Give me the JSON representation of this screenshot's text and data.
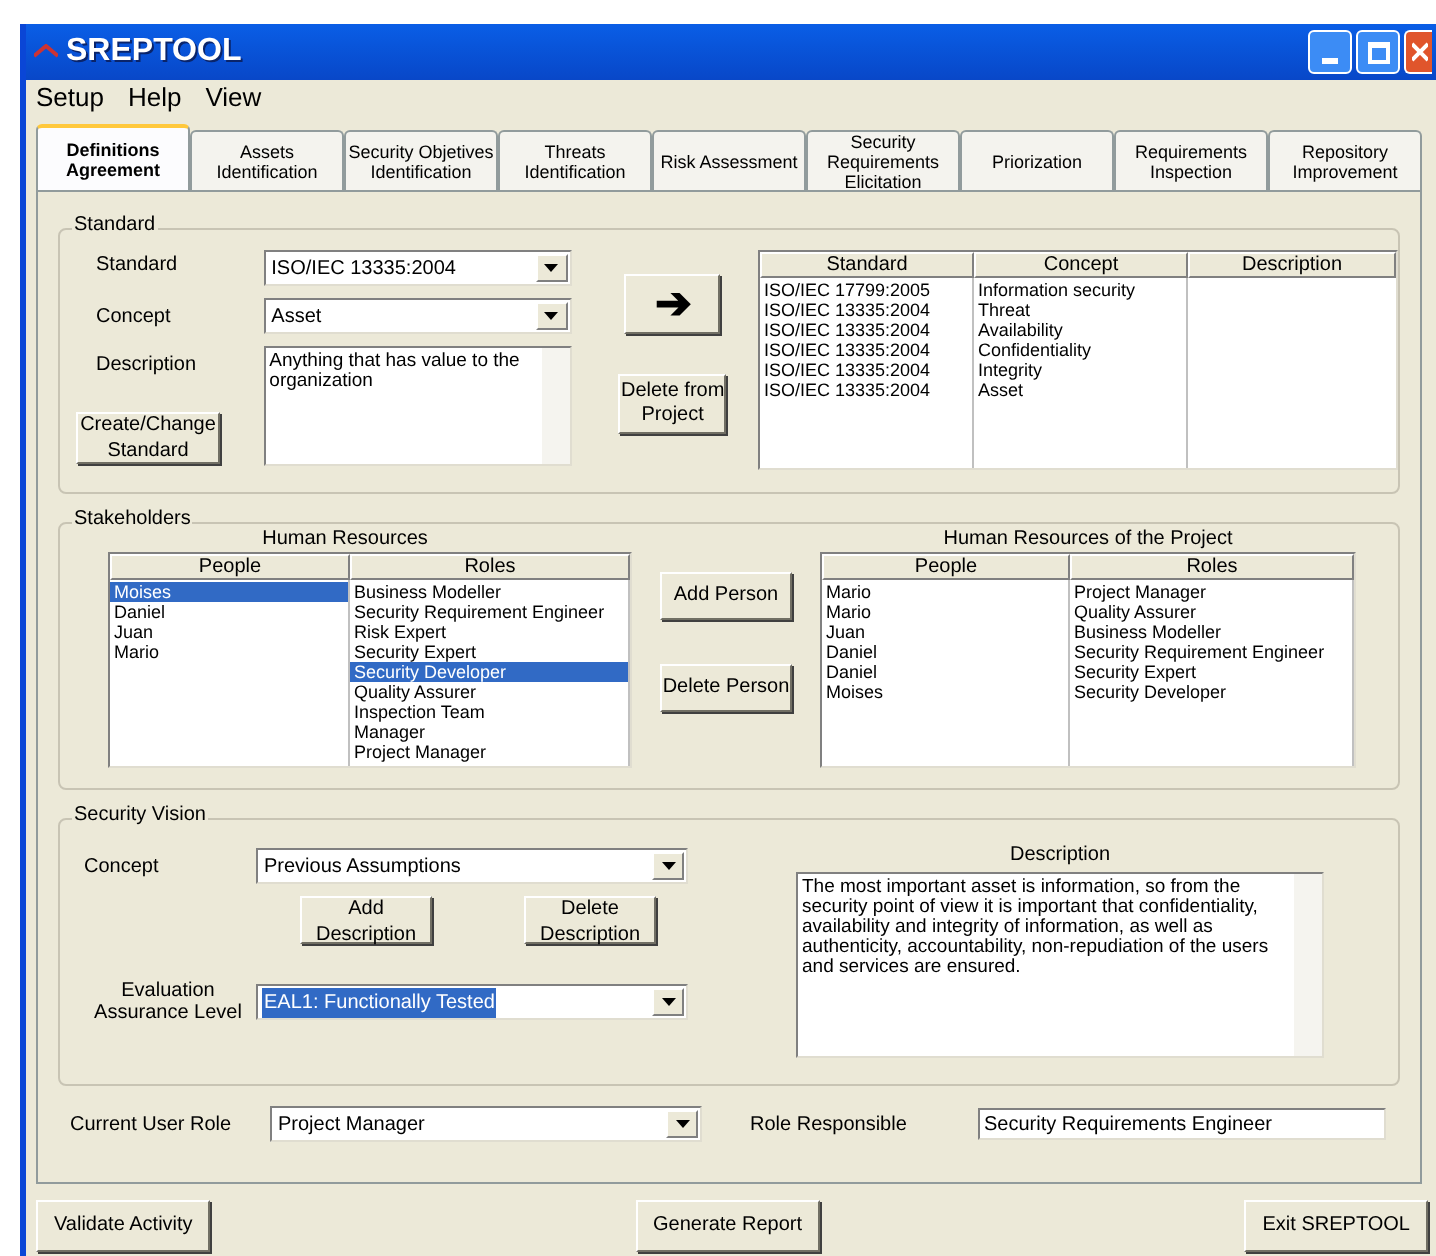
{
  "window": {
    "title": "SREPTOOL"
  },
  "menu": [
    "Setup",
    "Help",
    "View"
  ],
  "tabs": [
    {
      "label": "Definitions Agreement",
      "selected": true
    },
    {
      "label": "Assets Identification",
      "selected": false
    },
    {
      "label": "Security Objetives Identification",
      "selected": false
    },
    {
      "label": "Threats Identification",
      "selected": false
    },
    {
      "label": "Risk Assessment",
      "selected": false
    },
    {
      "label": "Security Requirements Elicitation",
      "selected": false
    },
    {
      "label": "Priorization",
      "selected": false
    },
    {
      "label": "Requirements Inspection",
      "selected": false
    },
    {
      "label": "Repository Improvement",
      "selected": false
    }
  ],
  "standard": {
    "title": "Standard",
    "standard_label": "Standard",
    "standard_value": "ISO/IEC 13335:2004",
    "concept_label": "Concept",
    "concept_value": "Asset",
    "description_label": "Description",
    "description_value": "Anything that has value to the organization",
    "create_button": "Create/Change Standard",
    "add_symbol": "➔",
    "delete_button": "Delete from Project",
    "table": {
      "columns": [
        "Standard",
        "Concept",
        "Description"
      ],
      "rows": [
        {
          "standard": "ISO/IEC 17799:2005",
          "concept": "Information security"
        },
        {
          "standard": "ISO/IEC 13335:2004",
          "concept": "Threat"
        },
        {
          "standard": "ISO/IEC 13335:2004",
          "concept": "Availability"
        },
        {
          "standard": "ISO/IEC 13335:2004",
          "concept": "Confidentiality"
        },
        {
          "standard": "ISO/IEC 13335:2004",
          "concept": "Integrity"
        },
        {
          "standard": "ISO/IEC 13335:2004",
          "concept": "Asset"
        }
      ]
    }
  },
  "stakeholders": {
    "title": "Stakeholders",
    "resources_title": "Human Resources",
    "columns": [
      "People",
      "Roles"
    ],
    "people": [
      {
        "name": "Moises",
        "selected": true
      },
      {
        "name": "Daniel",
        "selected": false
      },
      {
        "name": "Juan",
        "selected": false
      },
      {
        "name": "Mario",
        "selected": false
      }
    ],
    "roles": [
      {
        "name": "Business Modeller",
        "selected": false
      },
      {
        "name": "Security Requirement Engineer",
        "selected": false
      },
      {
        "name": "Risk Expert",
        "selected": false
      },
      {
        "name": "Security Expert",
        "selected": false
      },
      {
        "name": "Security Developer",
        "selected": true
      },
      {
        "name": "Quality Assurer",
        "selected": false
      },
      {
        "name": "Inspection Team",
        "selected": false
      },
      {
        "name": "Manager",
        "selected": false
      },
      {
        "name": "Project Manager",
        "selected": false
      }
    ],
    "add_button": "Add Person",
    "delete_button": "Delete Person",
    "project_title": "Human Resources of the Project",
    "project_columns": [
      "People",
      "Roles"
    ],
    "project_people": [
      "Mario",
      "Mario",
      "Juan",
      "Daniel",
      "Daniel",
      "Moises"
    ],
    "project_roles": [
      "Project Manager",
      "Quality Assurer",
      "Business Modeller",
      "Security Requirement Engineer",
      "Security Expert",
      "Security Developer"
    ]
  },
  "vision": {
    "title": "Security Vision",
    "concept_label": "Concept",
    "concept_value": "Previous Assumptions",
    "add_button": "Add Description",
    "delete_button": "Delete Description",
    "eal_label": "Evaluation Assurance Level",
    "eal_value": "EAL1: Functionally Tested",
    "eal_highlighted": true,
    "description_title": "Description",
    "description_value": "The most important asset is information, so from the security point of view it is important that confidentiality, availability and integrity of information, as well as authenticity, accountability, non-repudiation of the users and services are ensured."
  },
  "role": {
    "current_label": "Current User Role",
    "current_value": "Project Manager",
    "responsible_label": "Role Responsible",
    "responsible_value": "Security Requirements Engineer"
  },
  "buttons": [
    "Validate Activity",
    "Generate Report",
    "Exit SREPTOOL"
  ]
}
